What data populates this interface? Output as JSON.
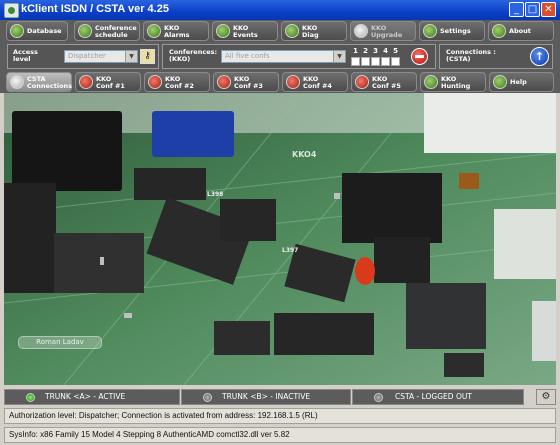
{
  "window": {
    "title": "kClient ISDN / CSTA ver  4.25",
    "controls": {
      "minimize": "_",
      "maximize": "□",
      "close": "✕"
    }
  },
  "toolbar_main": {
    "items": [
      {
        "label": "Database",
        "icon": "database-icon"
      },
      {
        "label": "Conference\nschedule",
        "icon": "calendar-icon"
      },
      {
        "label": "KKO\nAlarms",
        "icon": "alarm-icon"
      },
      {
        "label": "KKO\nEvents",
        "icon": "events-icon"
      },
      {
        "label": "KKO\nDiag",
        "icon": "diag-icon"
      },
      {
        "label": "KKO\nUpgrade",
        "icon": "upgrade-icon"
      },
      {
        "label": "Settings",
        "icon": "gear-icon"
      },
      {
        "label": "About",
        "icon": "info-icon"
      }
    ]
  },
  "access": {
    "label": "Access\nlevel",
    "value": "Dispatcher",
    "key_icon": "key-icon"
  },
  "conferences": {
    "label": "Conferences:\n(KKO)",
    "value": "All five confs",
    "numbers": [
      "1",
      "2",
      "3",
      "4",
      "5"
    ]
  },
  "connections": {
    "label": "Connections :\n(CSTA)"
  },
  "toolbar_conf": {
    "items": [
      {
        "label": "CSTA\nConnections",
        "icon": "connections-icon"
      },
      {
        "label": "KKO\nConf #1",
        "icon": "phone-icon"
      },
      {
        "label": "KKO\nConf #2",
        "icon": "phone-icon"
      },
      {
        "label": "KKO\nConf #3",
        "icon": "phone-icon"
      },
      {
        "label": "KKO\nConf #4",
        "icon": "phone-icon"
      },
      {
        "label": "KKO\nConf #5",
        "icon": "phone-icon"
      },
      {
        "label": "KKO\nHunting",
        "icon": "hunting-icon"
      },
      {
        "label": "Help",
        "icon": "help-icon"
      }
    ]
  },
  "photo": {
    "watermark": "Roman Ladav",
    "chip_label_1": "L398",
    "chip_label_2": "L397",
    "board_label": "KKO4"
  },
  "status": {
    "trunk_a": "TRUNK <A> - ACTIVE",
    "trunk_b": "TRUNK <B> - INACTIVE",
    "csta": "CSTA - LOGGED OUT",
    "lock_icon": "lock-icon"
  },
  "info": {
    "authorization": "Authorization level: Dispatcher; Connection is activated from address: 192.168.1.5 (RL)",
    "sysinfo": "SysInfo: x86 Family 15 Model 4 Stepping 8 AuthenticAMD      comctl32.dll ver 5.82"
  }
}
